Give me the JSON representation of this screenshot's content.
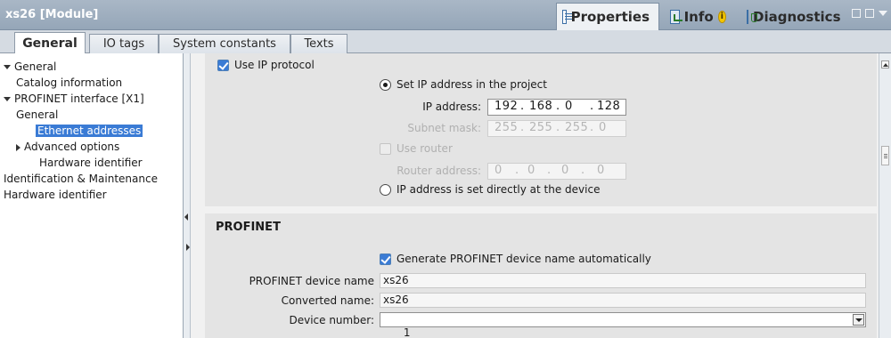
{
  "window": {
    "title": "xs26 [Module]",
    "inspector_tabs": [
      {
        "label": "Properties",
        "icon": "properties-icon",
        "active": true
      },
      {
        "label": "Info",
        "icon": "info-icon",
        "active": false
      },
      {
        "label": "Diagnostics",
        "icon": "diagnostics-icon",
        "active": false
      }
    ]
  },
  "tabs": [
    {
      "label": "General",
      "active": true
    },
    {
      "label": "IO tags",
      "active": false
    },
    {
      "label": "System constants",
      "active": false
    },
    {
      "label": "Texts",
      "active": false
    }
  ],
  "sidebar": {
    "items": [
      {
        "label": "General",
        "expanded": true
      },
      {
        "label": "Catalog information"
      },
      {
        "label": "PROFINET interface [X1]",
        "expanded": true
      },
      {
        "label": "General"
      },
      {
        "label": "Ethernet addresses",
        "selected": true
      },
      {
        "label": "Advanced options",
        "collapsed": true
      },
      {
        "label": "Hardware identifier"
      },
      {
        "label": "Identification & Maintenance"
      },
      {
        "label": "Hardware identifier"
      }
    ]
  },
  "ip_section": {
    "use_ip_protocol": {
      "label": "Use IP protocol",
      "checked": true
    },
    "set_ip_in_project": {
      "label": "Set IP address in the project",
      "selected": true
    },
    "ip_address": {
      "label": "IP address:",
      "octets": [
        "192",
        "168",
        "0",
        "128"
      ]
    },
    "subnet_mask": {
      "label": "Subnet mask:",
      "octets": [
        "255",
        "255",
        "255",
        "0"
      ]
    },
    "use_router": {
      "label": "Use router",
      "checked": false
    },
    "router_address": {
      "label": "Router address:",
      "octets": [
        "0",
        "0",
        "0",
        "0"
      ]
    },
    "ip_set_at_device": {
      "label": "IP address is set directly at the device",
      "selected": false
    }
  },
  "profinet_section": {
    "heading": "PROFINET",
    "auto_name": {
      "label": "Generate PROFINET device name automatically",
      "checked": true
    },
    "device_name": {
      "label": "PROFINET device name",
      "value": "xs26"
    },
    "converted_name": {
      "label": "Converted name:",
      "value": "xs26"
    },
    "device_number": {
      "label": "Device number:",
      "value": "1"
    }
  },
  "colors": {
    "titlebar": "#a9b7c6",
    "selection": "#3a7bd5",
    "section_bg": "#e4e4e4"
  }
}
